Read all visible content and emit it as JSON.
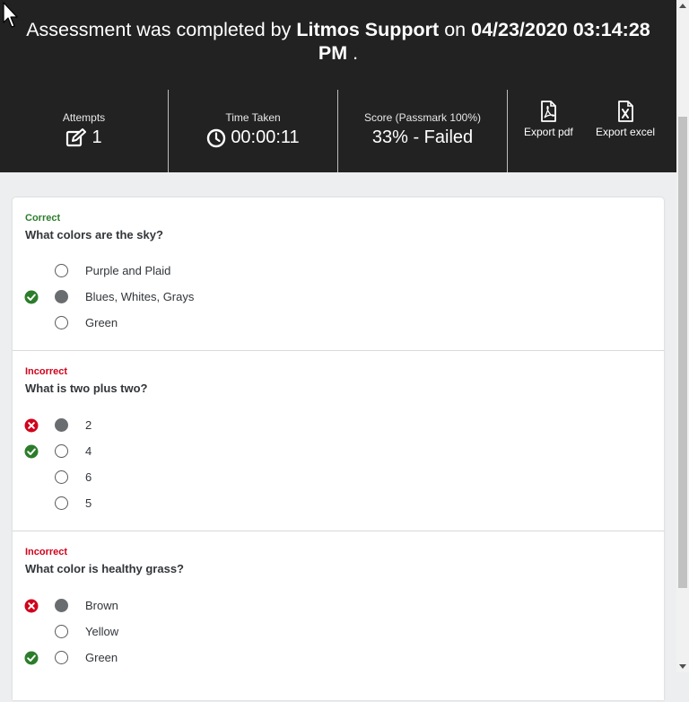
{
  "banner": {
    "prefix": "Assessment was completed by",
    "user": "Litmos Support",
    "on": "on",
    "datetime": "04/23/2020 03:14:28",
    "ampm": "PM",
    "end": "."
  },
  "stats": {
    "attempts_label": "Attempts",
    "attempts_value": "1",
    "time_label": "Time Taken",
    "time_value": "00:00:11",
    "score_label": "Score (Passmark 100%)",
    "score_value": "33% - Failed"
  },
  "exports": {
    "pdf_label": "Export pdf",
    "excel_label": "Export excel"
  },
  "questions": [
    {
      "status": "Correct",
      "text": "What colors are the sky?",
      "options": [
        {
          "label": "Purple and Plaid",
          "selected": false,
          "mark": ""
        },
        {
          "label": "Blues, Whites, Grays",
          "selected": true,
          "mark": "correct"
        },
        {
          "label": "Green",
          "selected": false,
          "mark": ""
        }
      ]
    },
    {
      "status": "Incorrect",
      "text": "What is two plus two?",
      "options": [
        {
          "label": "2",
          "selected": true,
          "mark": "incorrect"
        },
        {
          "label": "4",
          "selected": false,
          "mark": "correct"
        },
        {
          "label": "6",
          "selected": false,
          "mark": ""
        },
        {
          "label": "5",
          "selected": false,
          "mark": ""
        }
      ]
    },
    {
      "status": "Incorrect",
      "text": "What color is healthy grass?",
      "options": [
        {
          "label": "Brown",
          "selected": true,
          "mark": "incorrect"
        },
        {
          "label": "Yellow",
          "selected": false,
          "mark": ""
        },
        {
          "label": "Green",
          "selected": false,
          "mark": "correct"
        }
      ]
    }
  ],
  "colors": {
    "header_bg": "#222222",
    "correct": "#2b7d2b",
    "incorrect": "#d0021b"
  }
}
